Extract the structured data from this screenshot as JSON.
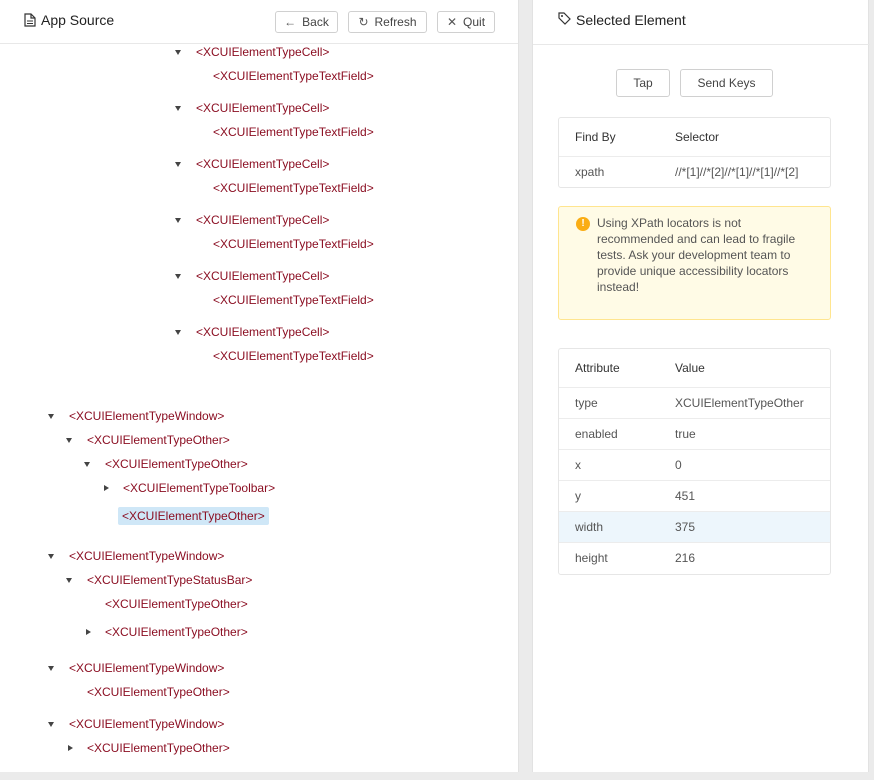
{
  "left": {
    "title": "App Source",
    "buttons": {
      "back": "Back",
      "refresh": "Refresh",
      "quit": "Quit"
    },
    "tree": [
      {
        "label": "<XCUIElementTypeCell>",
        "caret": "down"
      },
      {
        "label": "<XCUIElementTypeTextField>",
        "caret": "none"
      },
      {
        "label": "<XCUIElementTypeCell>",
        "caret": "down"
      },
      {
        "label": "<XCUIElementTypeTextField>",
        "caret": "none"
      },
      {
        "label": "<XCUIElementTypeCell>",
        "caret": "down"
      },
      {
        "label": "<XCUIElementTypeTextField>",
        "caret": "none"
      },
      {
        "label": "<XCUIElementTypeCell>",
        "caret": "down"
      },
      {
        "label": "<XCUIElementTypeTextField>",
        "caret": "none"
      },
      {
        "label": "<XCUIElementTypeCell>",
        "caret": "down"
      },
      {
        "label": "<XCUIElementTypeTextField>",
        "caret": "none"
      },
      {
        "label": "<XCUIElementTypeCell>",
        "caret": "down"
      },
      {
        "label": "<XCUIElementTypeTextField>",
        "caret": "none"
      },
      {
        "label": "<XCUIElementTypeWindow>",
        "caret": "down"
      },
      {
        "label": "<XCUIElementTypeOther>",
        "caret": "down"
      },
      {
        "label": "<XCUIElementTypeOther>",
        "caret": "down"
      },
      {
        "label": "<XCUIElementTypeToolbar>",
        "caret": "right"
      },
      {
        "label": "<XCUIElementTypeOther>",
        "caret": "none",
        "selected": true
      },
      {
        "label": "<XCUIElementTypeWindow>",
        "caret": "down"
      },
      {
        "label": "<XCUIElementTypeStatusBar>",
        "caret": "down"
      },
      {
        "label": "<XCUIElementTypeOther>",
        "caret": "none"
      },
      {
        "label": "<XCUIElementTypeOther>",
        "caret": "right"
      },
      {
        "label": "<XCUIElementTypeWindow>",
        "caret": "down"
      },
      {
        "label": "<XCUIElementTypeOther>",
        "caret": "none"
      },
      {
        "label": "<XCUIElementTypeWindow>",
        "caret": "down"
      },
      {
        "label": "<XCUIElementTypeOther>",
        "caret": "right"
      }
    ]
  },
  "right": {
    "title": "Selected Element",
    "actions": {
      "tap": "Tap",
      "send_keys": "Send Keys"
    },
    "selector_table": {
      "headers": [
        "Find By",
        "Selector"
      ],
      "rows": [
        [
          "xpath",
          "//*[1]//*[2]//*[1]//*[1]//*[2]"
        ]
      ]
    },
    "warning": "Using XPath locators is not recommended and can lead to fragile tests. Ask your development team to provide unique accessibility locators instead!",
    "attributes": {
      "headers": [
        "Attribute",
        "Value"
      ],
      "rows": [
        [
          "type",
          "XCUIElementTypeOther"
        ],
        [
          "enabled",
          "true"
        ],
        [
          "x",
          "0"
        ],
        [
          "y",
          "451"
        ],
        [
          "width",
          "375"
        ],
        [
          "height",
          "216"
        ]
      ]
    }
  }
}
